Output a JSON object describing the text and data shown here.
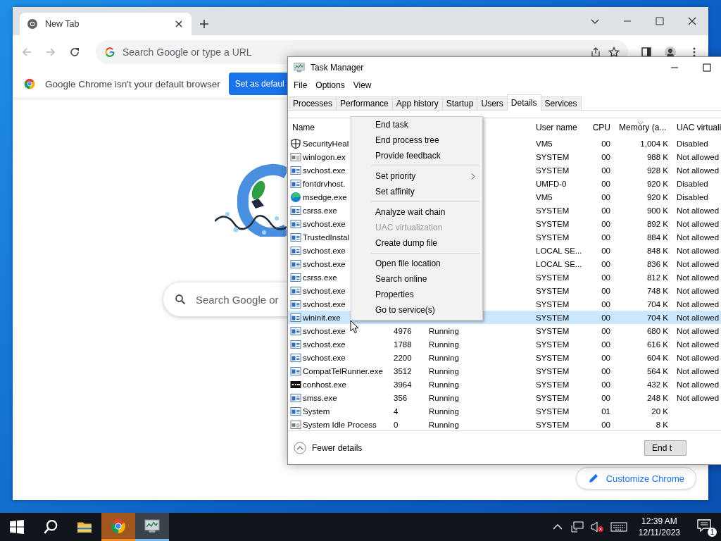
{
  "chrome": {
    "tab": {
      "title": "New Tab"
    },
    "omnibox": {
      "placeholder": "Search Google or type a URL"
    },
    "infobar": {
      "message": "Google Chrome isn't your default browser",
      "button": "Set as defaul"
    },
    "search": {
      "placeholder": "Search Google or"
    },
    "customize_button": "Customize Chrome"
  },
  "task_manager": {
    "title": "Task Manager",
    "menu": [
      "File",
      "Options",
      "View"
    ],
    "tabs": [
      {
        "label": "Processes",
        "selected": false
      },
      {
        "label": "Performance",
        "selected": false
      },
      {
        "label": "App history",
        "selected": false
      },
      {
        "label": "Startup",
        "selected": false
      },
      {
        "label": "Users",
        "selected": false
      },
      {
        "label": "Details",
        "selected": true
      },
      {
        "label": "Services",
        "selected": false
      }
    ],
    "columns": {
      "name": "Name",
      "user": "User name",
      "cpu": "CPU",
      "memory": "Memory (a...",
      "uac": "UAC virtuali"
    },
    "rows": [
      {
        "kind": "shield",
        "name": "SecurityHeal",
        "user": "VM5",
        "cpu": "00",
        "memory": "1,004 K",
        "uac": "Disabled",
        "selected": false
      },
      {
        "kind": "window",
        "name": "winlogon.ex",
        "user": "SYSTEM",
        "cpu": "00",
        "memory": "988 K",
        "uac": "Not allowed",
        "selected": false
      },
      {
        "kind": "app",
        "name": "svchost.exe",
        "user": "SYSTEM",
        "cpu": "00",
        "memory": "928 K",
        "uac": "Not allowed",
        "selected": false
      },
      {
        "kind": "app",
        "name": "fontdrvhost.",
        "user": "UMFD-0",
        "cpu": "00",
        "memory": "920 K",
        "uac": "Disabled",
        "selected": false
      },
      {
        "kind": "edge",
        "name": "msedge.exe",
        "user": "VM5",
        "cpu": "00",
        "memory": "920 K",
        "uac": "Disabled",
        "selected": false
      },
      {
        "kind": "app",
        "name": "csrss.exe",
        "user": "SYSTEM",
        "cpu": "00",
        "memory": "900 K",
        "uac": "Not allowed",
        "selected": false
      },
      {
        "kind": "app",
        "name": "svchost.exe",
        "user": "SYSTEM",
        "cpu": "00",
        "memory": "892 K",
        "uac": "Not allowed",
        "selected": false
      },
      {
        "kind": "app",
        "name": "TrustedInstal",
        "user": "SYSTEM",
        "cpu": "00",
        "memory": "884 K",
        "uac": "Not allowed",
        "selected": false
      },
      {
        "kind": "app",
        "name": "svchost.exe",
        "user": "LOCAL SE...",
        "cpu": "00",
        "memory": "848 K",
        "uac": "Not allowed",
        "selected": false
      },
      {
        "kind": "app",
        "name": "svchost.exe",
        "user": "LOCAL SE...",
        "cpu": "00",
        "memory": "836 K",
        "uac": "Not allowed",
        "selected": false
      },
      {
        "kind": "app",
        "name": "csrss.exe",
        "user": "SYSTEM",
        "cpu": "00",
        "memory": "812 K",
        "uac": "Not allowed",
        "selected": false
      },
      {
        "kind": "app",
        "name": "svchost.exe",
        "user": "SYSTEM",
        "cpu": "00",
        "memory": "748 K",
        "uac": "Not allowed",
        "selected": false
      },
      {
        "kind": "app",
        "name": "svchost.exe",
        "user": "SYSTEM",
        "cpu": "00",
        "memory": "704 K",
        "uac": "Not allowed",
        "selected": false
      },
      {
        "kind": "app",
        "name": "wininit.exe",
        "user": "SYSTEM",
        "cpu": "00",
        "memory": "704 K",
        "uac": "Not allowed",
        "selected": true
      },
      {
        "kind": "app",
        "name": "svchost.exe",
        "pid": "4976",
        "status": "Running",
        "user": "SYSTEM",
        "cpu": "00",
        "memory": "680 K",
        "uac": "Not allowed",
        "selected": false
      },
      {
        "kind": "app",
        "name": "svchost.exe",
        "pid": "1788",
        "status": "Running",
        "user": "SYSTEM",
        "cpu": "00",
        "memory": "616 K",
        "uac": "Not allowed",
        "selected": false
      },
      {
        "kind": "app",
        "name": "svchost.exe",
        "pid": "2200",
        "status": "Running",
        "user": "SYSTEM",
        "cpu": "00",
        "memory": "604 K",
        "uac": "Not allowed",
        "selected": false
      },
      {
        "kind": "app",
        "name": "CompatTelRunner.exe",
        "pid": "3512",
        "status": "Running",
        "user": "SYSTEM",
        "cpu": "00",
        "memory": "564 K",
        "uac": "Not allowed",
        "selected": false
      },
      {
        "kind": "console",
        "name": "conhost.exe",
        "pid": "3964",
        "status": "Running",
        "user": "SYSTEM",
        "cpu": "00",
        "memory": "432 K",
        "uac": "Not allowed",
        "selected": false
      },
      {
        "kind": "app",
        "name": "smss.exe",
        "pid": "356",
        "status": "Running",
        "user": "SYSTEM",
        "cpu": "00",
        "memory": "248 K",
        "uac": "Not allowed",
        "selected": false
      },
      {
        "kind": "app",
        "name": "System",
        "pid": "4",
        "status": "Running",
        "user": "SYSTEM",
        "cpu": "01",
        "memory": "20 K",
        "selected": false
      },
      {
        "kind": "window",
        "name": "System Idle Process",
        "pid": "0",
        "status": "Running",
        "user": "SYSTEM",
        "cpu": "00",
        "memory": "8 K",
        "selected": false
      }
    ],
    "fewer_details": "Fewer details",
    "end_button": "End t"
  },
  "context_menu": {
    "groups": [
      [
        {
          "label": "End task",
          "disabled": false,
          "submenu": false
        },
        {
          "label": "End process tree",
          "disabled": false,
          "submenu": false
        },
        {
          "label": "Provide feedback",
          "disabled": false,
          "submenu": false
        }
      ],
      [
        {
          "label": "Set priority",
          "disabled": false,
          "submenu": true
        },
        {
          "label": "Set affinity",
          "disabled": false,
          "submenu": false
        }
      ],
      [
        {
          "label": "Analyze wait chain",
          "disabled": false,
          "submenu": false
        },
        {
          "label": "UAC virtualization",
          "disabled": true,
          "submenu": false
        },
        {
          "label": "Create dump file",
          "disabled": false,
          "submenu": false
        }
      ],
      [
        {
          "label": "Open file location",
          "disabled": false,
          "submenu": false
        },
        {
          "label": "Search online",
          "disabled": false,
          "submenu": false
        },
        {
          "label": "Properties",
          "disabled": false,
          "submenu": false
        },
        {
          "label": "Go to service(s)",
          "disabled": false,
          "submenu": false
        }
      ]
    ]
  },
  "taskbar": {
    "apps": [
      {
        "kind": "start",
        "flashing": false,
        "active": false
      },
      {
        "kind": "search",
        "flashing": false,
        "active": false
      },
      {
        "kind": "folder",
        "flashing": false,
        "active": false
      },
      {
        "kind": "chrome",
        "flashing": true,
        "active": false
      },
      {
        "kind": "task-manager",
        "flashing": false,
        "active": true
      }
    ],
    "time": "12:39 AM",
    "date": "12/11/2023",
    "notifications": "1"
  }
}
